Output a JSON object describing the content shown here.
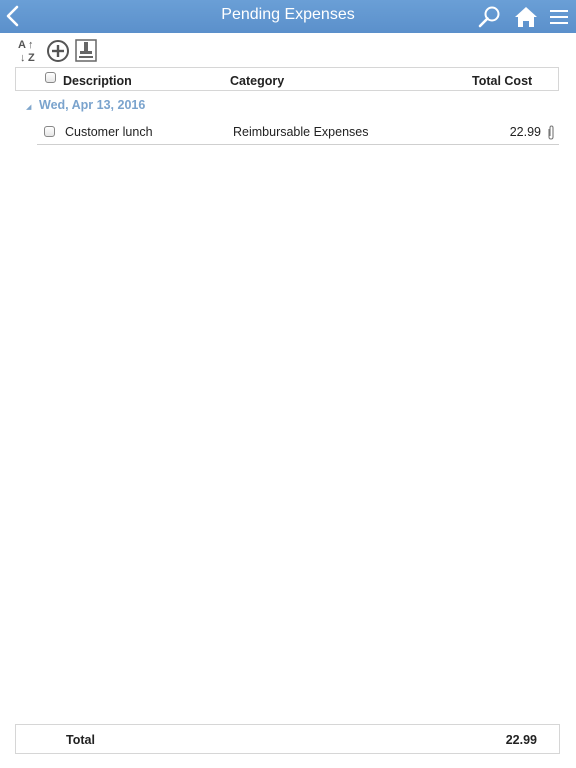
{
  "header": {
    "title": "Pending Expenses",
    "back_icon": "chevron-left-icon",
    "search_icon": "search-icon",
    "home_icon": "home-icon",
    "menu_icon": "hamburger-menu-icon",
    "background_color": "#5b90cb"
  },
  "toolbar": {
    "sort_icon": "sort-az-icon",
    "add_icon": "add-circle-icon",
    "submit_icon": "stamp-icon"
  },
  "table": {
    "columns": [
      "Description",
      "Category",
      "Total Cost"
    ],
    "groups": [
      {
        "date": "Wed, Apr 13, 2016",
        "rows": [
          {
            "description": "Customer lunch",
            "category": "Reimbursable Expenses",
            "total_cost": "22.99",
            "attachment_icon": "paperclip-icon"
          }
        ]
      }
    ]
  },
  "footer": {
    "label": "Total",
    "value": "22.99"
  },
  "colors": {
    "accent": "#5b90cb",
    "group_date": "#7aa3cd"
  }
}
